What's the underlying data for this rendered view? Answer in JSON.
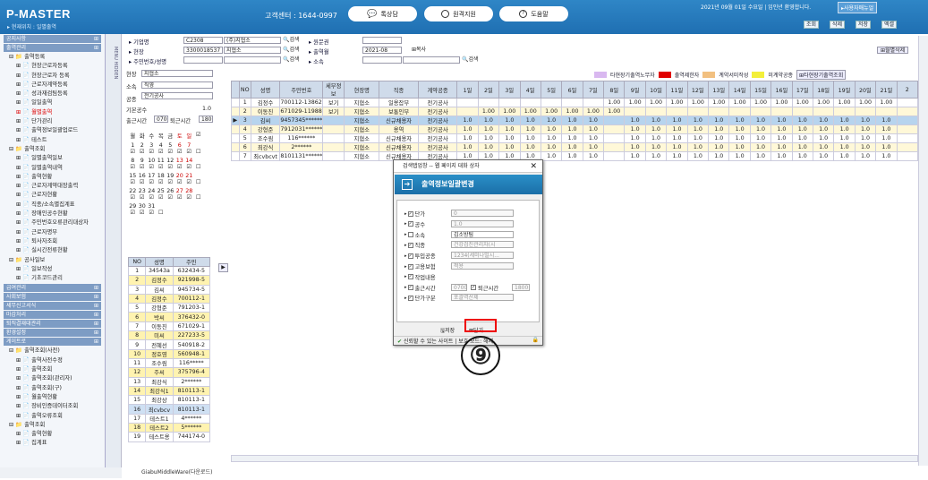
{
  "header": {
    "logo": "P-MASTER",
    "location": "▸ 현재위치 : 일별출역",
    "call_center": "고객센터 : 1644-0997",
    "buttons": [
      "톡상담",
      "원격지원",
      "도움말"
    ],
    "date": "2021년 09월 01일 수요일 | 임인년 환영합니다.",
    "manual": "▸사용자매뉴얼",
    "tools": [
      "조회",
      "삭제",
      "저장",
      "엑셀"
    ]
  },
  "sidebar": {
    "sections": [
      {
        "title": "공지사항",
        "items": []
      },
      {
        "title": "출역관리",
        "items": [
          {
            "label": "출역등록",
            "level": 1
          },
          {
            "label": "현장근로자등록"
          },
          {
            "label": "현장근로자 등록"
          },
          {
            "label": "근로자계약등록"
          },
          {
            "label": "성과재검팀등록"
          },
          {
            "label": "일일출역"
          },
          {
            "label": "월별출역",
            "hl": true
          },
          {
            "label": "단가관리"
          },
          {
            "label": "출역정보일괄업로드"
          },
          {
            "label": "테스트"
          },
          {
            "label": "출역조회",
            "level": 1
          },
          {
            "label": "일별출역일보"
          },
          {
            "label": "일별출역내역"
          },
          {
            "label": "출역현황"
          },
          {
            "label": "근로자계약대장출력"
          },
          {
            "label": "근로자현황"
          },
          {
            "label": "직종/소속별집계표"
          },
          {
            "label": "장애인공수현황"
          },
          {
            "label": "주민번호오류관리대상자"
          },
          {
            "label": "근로자명부"
          },
          {
            "label": "퇴사자조회"
          },
          {
            "label": "실시간전류현황"
          },
          {
            "label": "공사일보",
            "level": 1
          },
          {
            "label": "일보작성"
          },
          {
            "label": "기초코드관리"
          }
        ]
      },
      {
        "title": "급여관리",
        "items": []
      },
      {
        "title": "사회보험",
        "items": []
      },
      {
        "title": "세무신고서식",
        "items": []
      },
      {
        "title": "마감처리",
        "items": []
      },
      {
        "title": "퇴직결재대관리",
        "items": []
      },
      {
        "title": "환경설정",
        "items": []
      },
      {
        "title": "게이트로",
        "items": [
          {
            "label": "출역조회(사전)",
            "level": 1
          },
          {
            "label": "출역사전수정"
          },
          {
            "label": "출역조회"
          },
          {
            "label": "출역조회(관리자)"
          },
          {
            "label": "출역조회(구)"
          },
          {
            "label": "월출역현황"
          },
          {
            "label": "장비인증데이터조회"
          },
          {
            "label": "출역오류조회"
          },
          {
            "label": "출역조회",
            "level": 1
          },
          {
            "label": "출역현황"
          },
          {
            "label": "집계표"
          }
        ]
      }
    ]
  },
  "vertical_label": "MENU HIDDEN",
  "filters": {
    "company_label": "▸ 기업명",
    "company_code": "C2308",
    "company_name": "(주)지협소",
    "site_label": "▸ 현장",
    "site_code": "3300018537",
    "site_name": "지협소",
    "resident_label": "▸ 주민번호/성명",
    "search": "검색",
    "contract_label": "▸ 원문권",
    "month_label": "▸ 출역월",
    "month": "2021-08",
    "copy": "복사",
    "org_label": "▸ 소속",
    "del_btn": "월별삭제"
  },
  "legend": [
    {
      "label": "타현장기출역노무자",
      "color": "#d9b8f0"
    },
    {
      "label": "출역제한자",
      "color": "#e00000"
    },
    {
      "label": "계약서미작성",
      "color": "#f2c080"
    },
    {
      "label": "미계약공종",
      "color": "#f3ef3a"
    }
  ],
  "legend_btn": "타현장기출역조회",
  "left_panel": {
    "site": "현장",
    "site_val": "지협소",
    "org": "소속",
    "org_val": "직영",
    "trade": "공종",
    "trade_val": "전기공사",
    "base": "기본공수",
    "base_val": "1.0",
    "in_label": "출근시간",
    "in_val": "0700",
    "out_label": "퇴근시간",
    "out_val": "1800"
  },
  "calendar": {
    "weekdays": [
      "월",
      "화",
      "수",
      "목",
      "금",
      "토",
      "일"
    ],
    "rows": [
      [
        "1",
        "2",
        "3",
        "4",
        "5",
        "6",
        "7"
      ],
      [
        "8",
        "9",
        "10",
        "11",
        "12",
        "13",
        "14"
      ],
      [
        "15",
        "16",
        "17",
        "18",
        "19",
        "20",
        "21"
      ],
      [
        "22",
        "23",
        "24",
        "25",
        "26",
        "27",
        "28"
      ],
      [
        "29",
        "30",
        "31"
      ]
    ]
  },
  "grid": {
    "headers": [
      "NO",
      "성명",
      "주민번호",
      "세부정보",
      "현장명",
      "직종",
      "계약공종",
      "1일",
      "2일",
      "3일",
      "4일",
      "5일",
      "6일",
      "7일",
      "8일",
      "9일",
      "10일",
      "11일",
      "12일",
      "13일",
      "14일",
      "15일",
      "16일",
      "17일",
      "18일",
      "19일",
      "20일",
      "21일",
      "2"
    ],
    "rows": [
      [
        "1",
        "김정수",
        "700112-1386280",
        "보기",
        "지협소",
        "일용잡부",
        "전기공사",
        "",
        "",
        "",
        "",
        "",
        "",
        "",
        "1.00",
        "1.00",
        "1.00",
        "1.00",
        "1.00",
        "1.00",
        "1.00",
        "1.00",
        "1.00",
        "1.00",
        "1.00",
        "1.00",
        "1.00",
        "1.00",
        ""
      ],
      [
        "2",
        "이동진",
        "671029-1198831",
        "보기",
        "지협소",
        "보통인부",
        "전기공사",
        "",
        "1.00",
        "1.00",
        "1.00",
        "1.00",
        "1.00",
        "1.00",
        "1.00",
        "",
        "",
        "",
        "",
        "",
        "",
        "",
        "",
        "",
        "",
        "",
        "",
        "",
        ""
      ],
      [
        "3",
        "김씨",
        "9457345******",
        "",
        "지협소",
        "신규채용자",
        "전기공사",
        "1.0",
        "1.0",
        "1.0",
        "1.0",
        "1.0",
        "1.0",
        "1.0",
        "",
        "1.0",
        "1.0",
        "1.0",
        "1.0",
        "1.0",
        "1.0",
        "1.0",
        "1.0",
        "1.0",
        "1.0",
        "1.0",
        "1.0",
        "1.0",
        ""
      ],
      [
        "4",
        "강형준",
        "7912031******",
        "",
        "지협소",
        "용역",
        "전기공사",
        "1.0",
        "1.0",
        "1.0",
        "1.0",
        "1.0",
        "1.0",
        "1.0",
        "",
        "1.0",
        "1.0",
        "1.0",
        "1.0",
        "1.0",
        "1.0",
        "1.0",
        "1.0",
        "1.0",
        "1.0",
        "1.0",
        "1.0",
        "1.0",
        ""
      ],
      [
        "5",
        "조수림",
        "116******",
        "",
        "지협소",
        "신규채용자",
        "전기공사",
        "1.0",
        "1.0",
        "1.0",
        "1.0",
        "1.0",
        "1.0",
        "1.0",
        "",
        "1.0",
        "1.0",
        "1.0",
        "1.0",
        "1.0",
        "1.0",
        "1.0",
        "1.0",
        "1.0",
        "1.0",
        "1.0",
        "1.0",
        "1.0",
        ""
      ],
      [
        "6",
        "최강식",
        "2******",
        "",
        "지협소",
        "신규채용자",
        "전기공사",
        "1.0",
        "1.0",
        "1.0",
        "1.0",
        "1.0",
        "1.0",
        "1.0",
        "",
        "1.0",
        "1.0",
        "1.0",
        "1.0",
        "1.0",
        "1.0",
        "1.0",
        "1.0",
        "1.0",
        "1.0",
        "1.0",
        "1.0",
        "1.0",
        ""
      ],
      [
        "7",
        "최cvbcvt",
        "8101131******",
        "",
        "지협소",
        "신규채용자",
        "전기공사",
        "1.0",
        "1.0",
        "1.0",
        "1.0",
        "1.0",
        "1.0",
        "1.0",
        "",
        "1.0",
        "1.0",
        "1.0",
        "1.0",
        "1.0",
        "1.0",
        "1.0",
        "1.0",
        "1.0",
        "1.0",
        "1.0",
        "1.0",
        "1.0",
        ""
      ]
    ]
  },
  "bottom_list": {
    "headers": [
      "NO",
      "성명",
      "주민"
    ],
    "rows": [
      [
        "1",
        "34543a",
        "632434-5"
      ],
      [
        "2",
        "김정수",
        "921998-5"
      ],
      [
        "3",
        "김씨",
        "945734-5"
      ],
      [
        "4",
        "김정수",
        "700112-1"
      ],
      [
        "5",
        "강형준",
        "791203-1"
      ],
      [
        "6",
        "박씨",
        "376432-0"
      ],
      [
        "7",
        "이동진",
        "671029-1"
      ],
      [
        "8",
        "미씨",
        "227233-5"
      ],
      [
        "9",
        "전혜선",
        "540918-2"
      ],
      [
        "10",
        "정호영",
        "560948-1"
      ],
      [
        "11",
        "조수림",
        "116*****"
      ],
      [
        "12",
        "주씨",
        "375796-4"
      ],
      [
        "13",
        "최강식",
        "2******"
      ],
      [
        "14",
        "최강식1",
        "810113-1"
      ],
      [
        "15",
        "최강상",
        "810113-1"
      ],
      [
        "16",
        "최cvbcv",
        "810113-1"
      ],
      [
        "17",
        "테스트1",
        "4******"
      ],
      [
        "18",
        "테스트2",
        "5******"
      ],
      [
        "19",
        "테스트용",
        "744174-0"
      ]
    ]
  },
  "dialog": {
    "title": "검색탭업창 -- 웹 페이지 대화 상자",
    "heading": "출역정보일괄변경",
    "rows": [
      {
        "label": "단가",
        "value": "0",
        "on": false
      },
      {
        "label": "공수",
        "value": "1.0",
        "on": false
      },
      {
        "label": "소속",
        "value": "김소방팀",
        "on": true
      },
      {
        "label": "직종",
        "value": "건강검진관리자(시",
        "on": false
      },
      {
        "label": "투입공종",
        "value": "1234(세미나밀시...",
        "on": false
      },
      {
        "label": "고용보험",
        "value": "적용",
        "on": false
      },
      {
        "label": "작업내용",
        "value": "",
        "on": false
      },
      {
        "label": "출근시간",
        "value": "0700",
        "on": false
      },
      {
        "label": "단가구분",
        "value": "포괄역산제",
        "on": false
      }
    ],
    "out_label": "퇴근시간",
    "out_val": "1800",
    "save": "저장",
    "close": "닫기",
    "status": "신뢰할 수 있는 사이트 | 보호 모드: 해제"
  },
  "annotation": "⑨",
  "status_bar": "GiabuMiddleWare(다운로드)"
}
